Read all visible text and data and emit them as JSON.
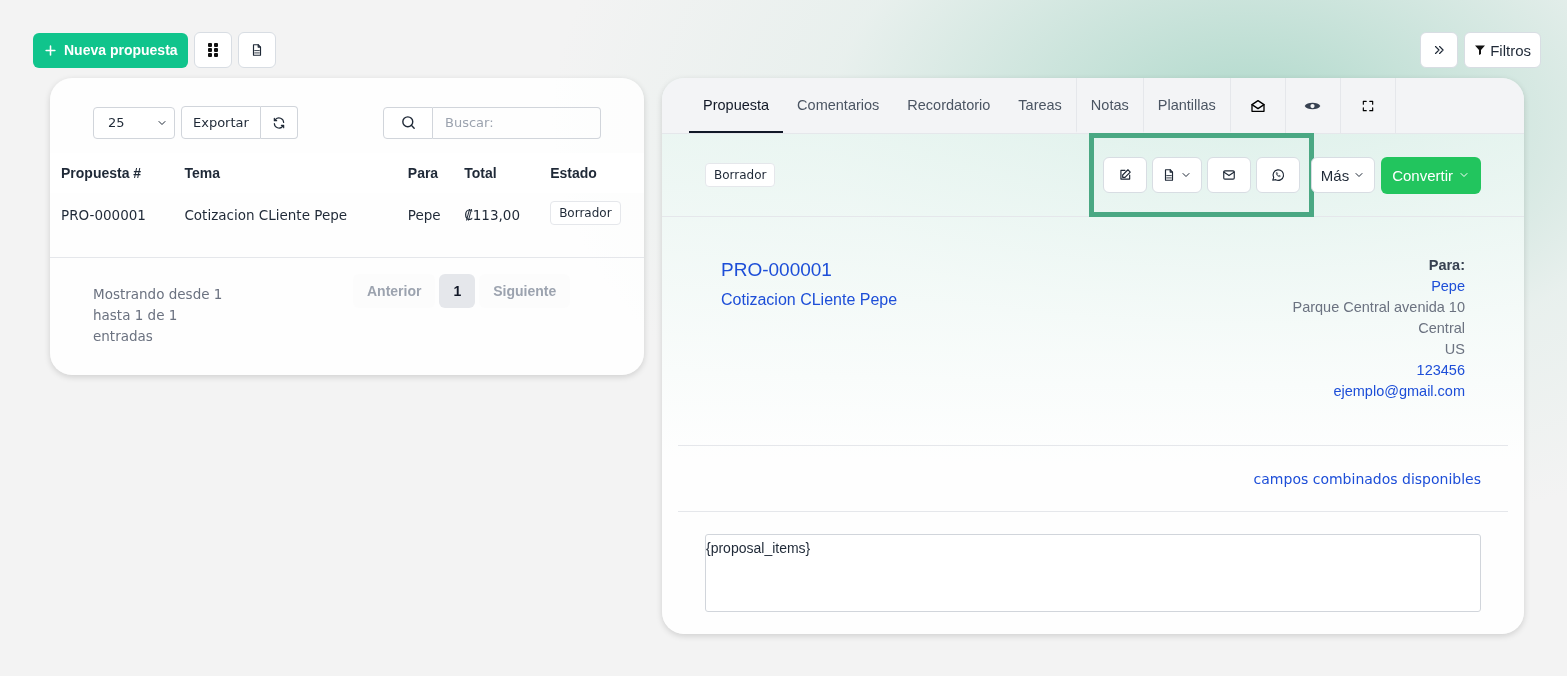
{
  "toolbar": {
    "new_button": "Nueva propuesta",
    "filters_button": "Filtros"
  },
  "list": {
    "page_size": "25",
    "export_button": "Exportar",
    "search": {
      "placeholder": "Buscar:"
    },
    "columns": [
      "Propuesta #",
      "Tema",
      "Para",
      "Total",
      "Estado"
    ],
    "rows": [
      {
        "number": "PRO-000001",
        "subject": "Cotizacion CLiente Pepe",
        "to": "Pepe",
        "total": "₡113,00",
        "status": "Borrador"
      }
    ],
    "info": "Mostrando desde 1 hasta 1 de 1 entradas",
    "pagination": {
      "previous": "Anterior",
      "pages": [
        {
          "label": "1",
          "selected": true
        }
      ],
      "next": "Siguiente"
    }
  },
  "detail": {
    "tabs": [
      {
        "label": "Propuesta",
        "selected": true
      },
      {
        "label": "Comentarios",
        "selected": false
      },
      {
        "label": "Recordatorio",
        "selected": false
      },
      {
        "label": "Tareas",
        "selected": false
      },
      {
        "label": "Notas",
        "selected": false
      },
      {
        "label": "Plantillas",
        "selected": false
      }
    ],
    "status": "Borrador",
    "more_button": "Más",
    "convert_button": "Convertir",
    "number": "PRO-000001",
    "subject": "Cotizacion CLiente Pepe",
    "to_label": "Para:",
    "to_name": "Pepe",
    "address": [
      "Parque Central avenida 10",
      "Central",
      "US"
    ],
    "phone": "123456",
    "email": "ejemplo@gmail.com",
    "merge_fields_link": "campos combinados disponibles",
    "content": "{proposal_items}"
  }
}
